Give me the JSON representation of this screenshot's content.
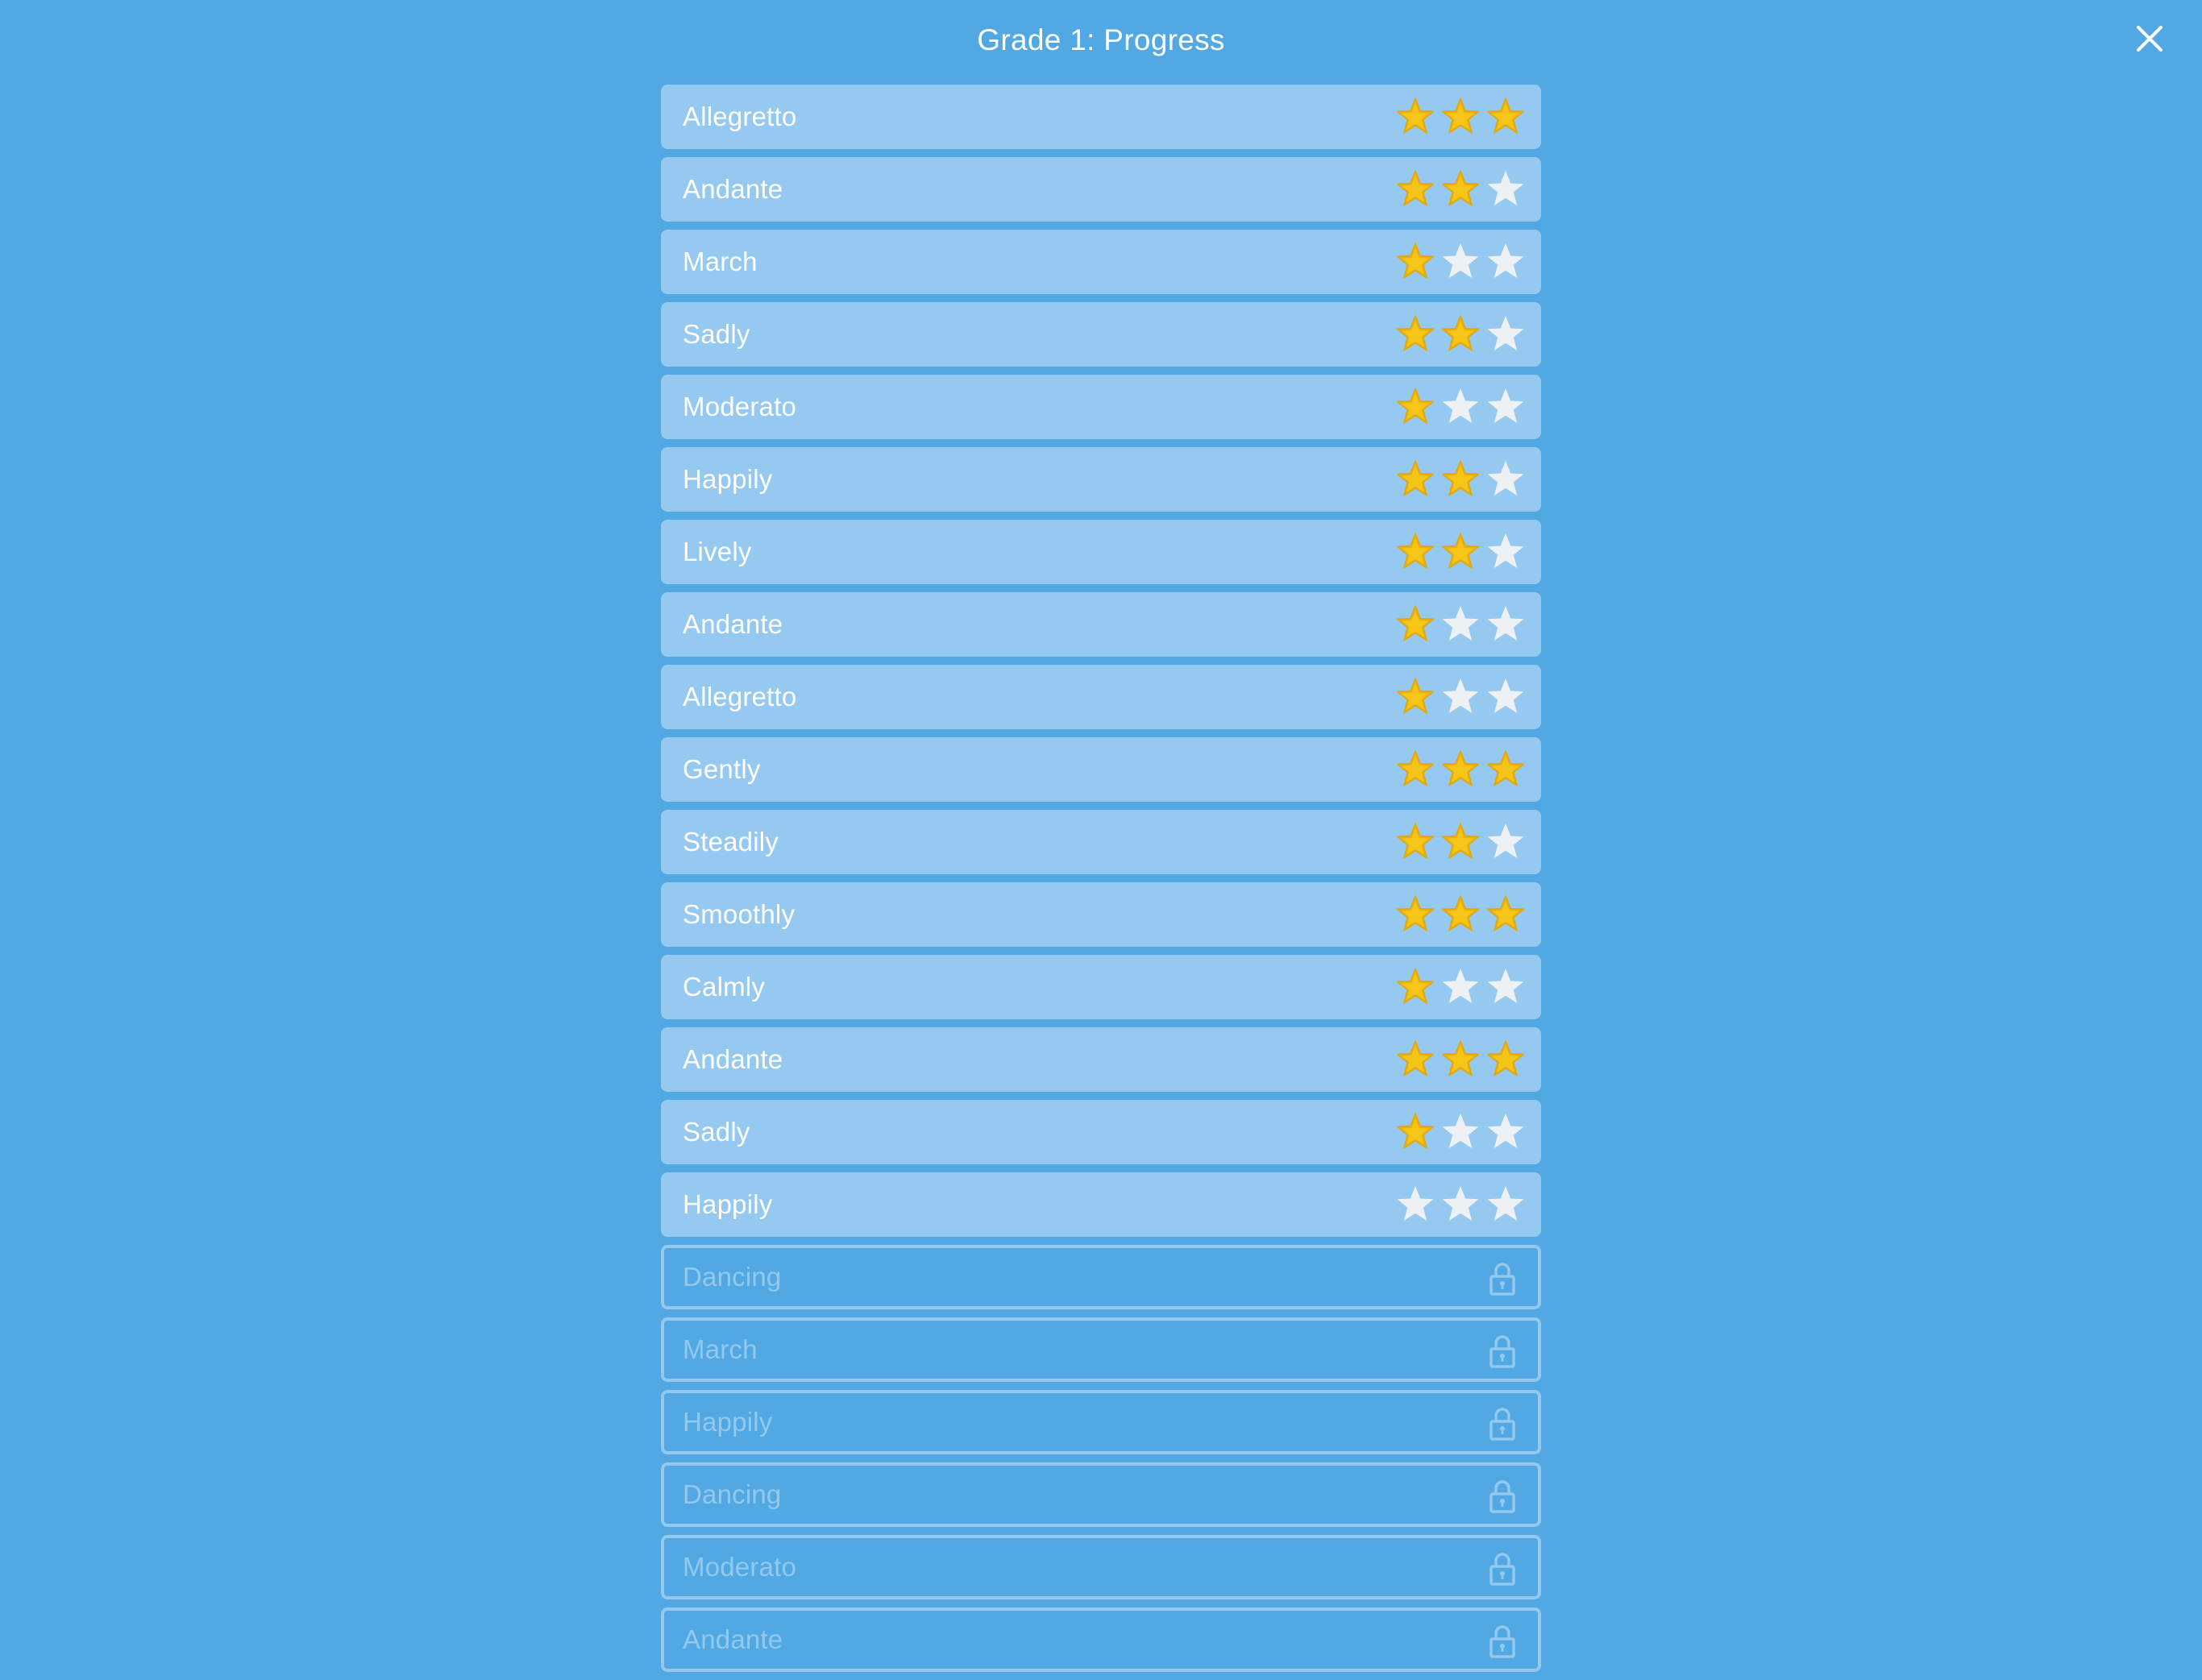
{
  "header": {
    "title": "Grade 1: Progress",
    "close_icon": "close-icon"
  },
  "colors": {
    "background": "#51A8E3",
    "row_fill": "#96C9EF",
    "locked_outline": "#93C8EF",
    "star_filled": "#F5C518",
    "star_empty": "#EEF1F4"
  },
  "max_stars": 3,
  "pieces": [
    {
      "name": "Allegretto",
      "stars": 3,
      "locked": false
    },
    {
      "name": "Andante",
      "stars": 2,
      "locked": false
    },
    {
      "name": "March",
      "stars": 1,
      "locked": false
    },
    {
      "name": "Sadly",
      "stars": 2,
      "locked": false
    },
    {
      "name": "Moderato",
      "stars": 1,
      "locked": false
    },
    {
      "name": "Happily",
      "stars": 2,
      "locked": false
    },
    {
      "name": "Lively",
      "stars": 2,
      "locked": false
    },
    {
      "name": "Andante",
      "stars": 1,
      "locked": false
    },
    {
      "name": "Allegretto",
      "stars": 1,
      "locked": false
    },
    {
      "name": "Gently",
      "stars": 3,
      "locked": false
    },
    {
      "name": "Steadily",
      "stars": 2,
      "locked": false
    },
    {
      "name": "Smoothly",
      "stars": 3,
      "locked": false
    },
    {
      "name": "Calmly",
      "stars": 1,
      "locked": false
    },
    {
      "name": "Andante",
      "stars": 3,
      "locked": false
    },
    {
      "name": "Sadly",
      "stars": 1,
      "locked": false
    },
    {
      "name": "Happily",
      "stars": 0,
      "locked": false
    },
    {
      "name": "Dancing",
      "locked": true,
      "icon": "lock-icon"
    },
    {
      "name": "March",
      "locked": true,
      "icon": "lock-icon"
    },
    {
      "name": "Happily",
      "locked": true,
      "icon": "lock-icon"
    },
    {
      "name": "Dancing",
      "locked": true,
      "icon": "lock-icon"
    },
    {
      "name": "Moderato",
      "locked": true,
      "icon": "lock-icon"
    },
    {
      "name": "Andante",
      "locked": true,
      "icon": "lock-icon"
    }
  ]
}
